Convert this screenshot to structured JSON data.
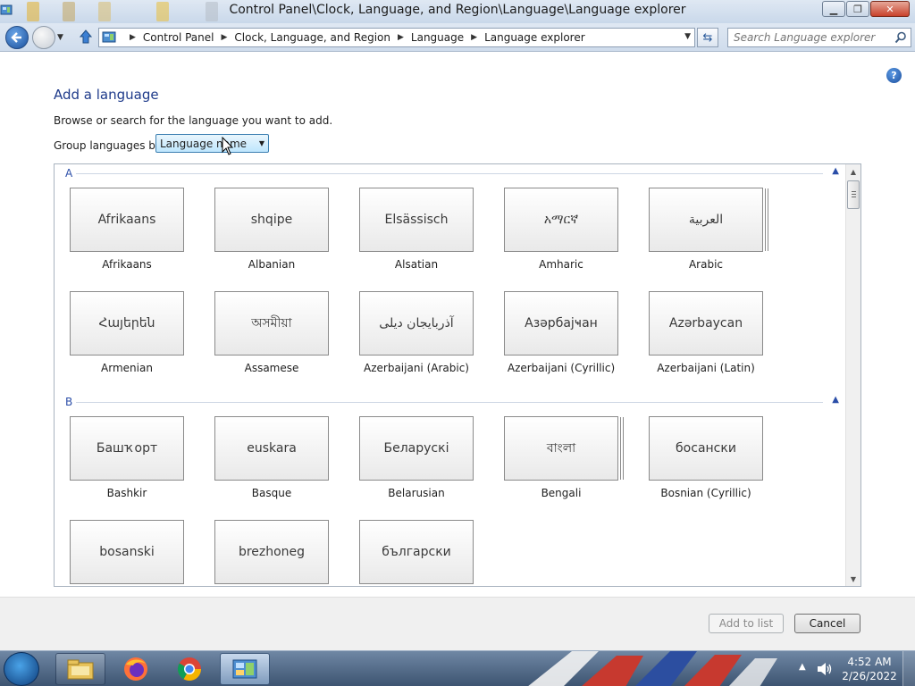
{
  "window": {
    "title": "Control Panel\\Clock, Language, and Region\\Language\\Language explorer",
    "minimize_icon": "minimize-icon",
    "maximize_icon": "maximize-icon",
    "close_icon": "close-icon"
  },
  "address_bar": {
    "breadcrumbs": [
      "Control Panel",
      "Clock, Language, and Region",
      "Language",
      "Language explorer"
    ]
  },
  "search": {
    "placeholder": "Search Language explorer"
  },
  "page": {
    "title": "Add a language",
    "description": "Browse or search for the language you want to add.",
    "group_label": "Group languages by:",
    "group_value": "Language name"
  },
  "groups": [
    {
      "letter": "A",
      "languages": [
        {
          "native": "Afrikaans",
          "name": "Afrikaans",
          "stacked": false
        },
        {
          "native": "shqipe",
          "name": "Albanian",
          "stacked": false
        },
        {
          "native": "Elsässisch",
          "name": "Alsatian",
          "stacked": false
        },
        {
          "native": "አማርኛ",
          "name": "Amharic",
          "stacked": false
        },
        {
          "native": "العربية",
          "name": "Arabic",
          "stacked": true
        },
        {
          "native": "Հայերեն",
          "name": "Armenian",
          "stacked": false
        },
        {
          "native": "অসমীয়া",
          "name": "Assamese",
          "stacked": false
        },
        {
          "native": "آذربايجان ديلی",
          "name": "Azerbaijani (Arabic)",
          "stacked": false
        },
        {
          "native": "Азәрбајҹан",
          "name": "Azerbaijani (Cyrillic)",
          "stacked": false
        },
        {
          "native": "Azərbaycan",
          "name": "Azerbaijani (Latin)",
          "stacked": false
        }
      ]
    },
    {
      "letter": "B",
      "languages": [
        {
          "native": "Башҡорт",
          "name": "Bashkir",
          "stacked": false
        },
        {
          "native": "euskara",
          "name": "Basque",
          "stacked": false
        },
        {
          "native": "Беларускі",
          "name": "Belarusian",
          "stacked": false
        },
        {
          "native": "বাংলা",
          "name": "Bengali",
          "stacked": true
        },
        {
          "native": "босански",
          "name": "Bosnian (Cyrillic)",
          "stacked": false
        },
        {
          "native": "bosanski",
          "name": "",
          "stacked": false
        },
        {
          "native": "brezhoneg",
          "name": "",
          "stacked": false
        },
        {
          "native": "български",
          "name": "",
          "stacked": false
        }
      ]
    }
  ],
  "buttons": {
    "add": "Add to list",
    "cancel": "Cancel"
  },
  "taskbar": {
    "items": [
      "start-orb-icon",
      "file-explorer-icon",
      "firefox-icon",
      "chrome-icon",
      "control-panel-icon"
    ],
    "time": "4:52 AM",
    "date": "2/26/2022"
  }
}
